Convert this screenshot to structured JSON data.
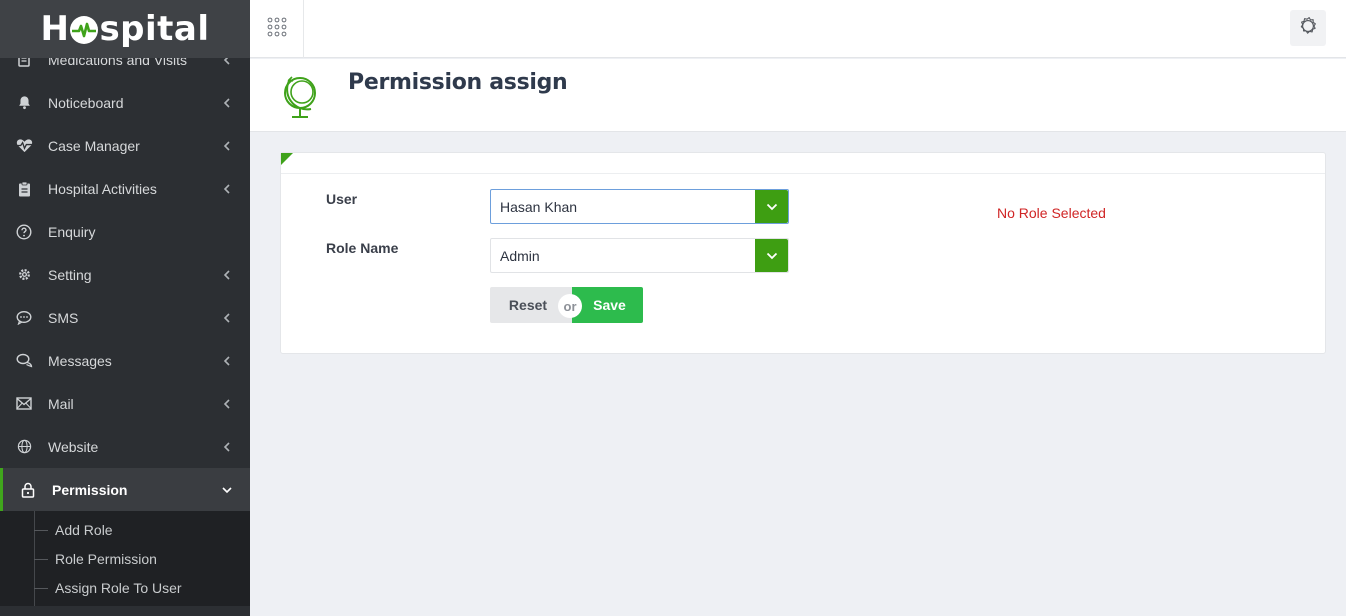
{
  "app": {
    "logo_parts": {
      "before": "H",
      "after": "spital"
    }
  },
  "sidebar": {
    "items": [
      {
        "label": "Medications and Visits",
        "icon": "notebook-icon",
        "has_chevron": true
      },
      {
        "label": "Noticeboard",
        "icon": "bell-icon",
        "has_chevron": true
      },
      {
        "label": "Case Manager",
        "icon": "heartbeat-icon",
        "has_chevron": true
      },
      {
        "label": "Hospital Activities",
        "icon": "clipboard-icon",
        "has_chevron": true
      },
      {
        "label": "Enquiry",
        "icon": "question-circle-icon",
        "has_chevron": false
      },
      {
        "label": "Setting",
        "icon": "gear-icon",
        "has_chevron": true
      },
      {
        "label": "SMS",
        "icon": "chat-bubble-icon",
        "has_chevron": true
      },
      {
        "label": "Messages",
        "icon": "messages-icon",
        "has_chevron": true
      },
      {
        "label": "Mail",
        "icon": "envelope-icon",
        "has_chevron": true
      },
      {
        "label": "Website",
        "icon": "globe-icon",
        "has_chevron": true
      },
      {
        "label": "Permission",
        "icon": "lock-icon",
        "has_chevron": true,
        "active": true
      }
    ],
    "submenu": [
      "Add Role",
      "Role Permission",
      "Assign Role To User"
    ],
    "accent_color": "#40a61c"
  },
  "page": {
    "title": "Permission assign"
  },
  "form": {
    "user_label": "User",
    "user_value": "Hasan Khan",
    "role_label": "Role Name",
    "role_value": "Admin",
    "status_message": "No Role Selected",
    "reset_label": "Reset",
    "or_label": "or",
    "save_label": "Save"
  },
  "colors": {
    "primary_green": "#3e9e12",
    "save_green": "#2dbb4d",
    "error_red": "#d02525"
  }
}
